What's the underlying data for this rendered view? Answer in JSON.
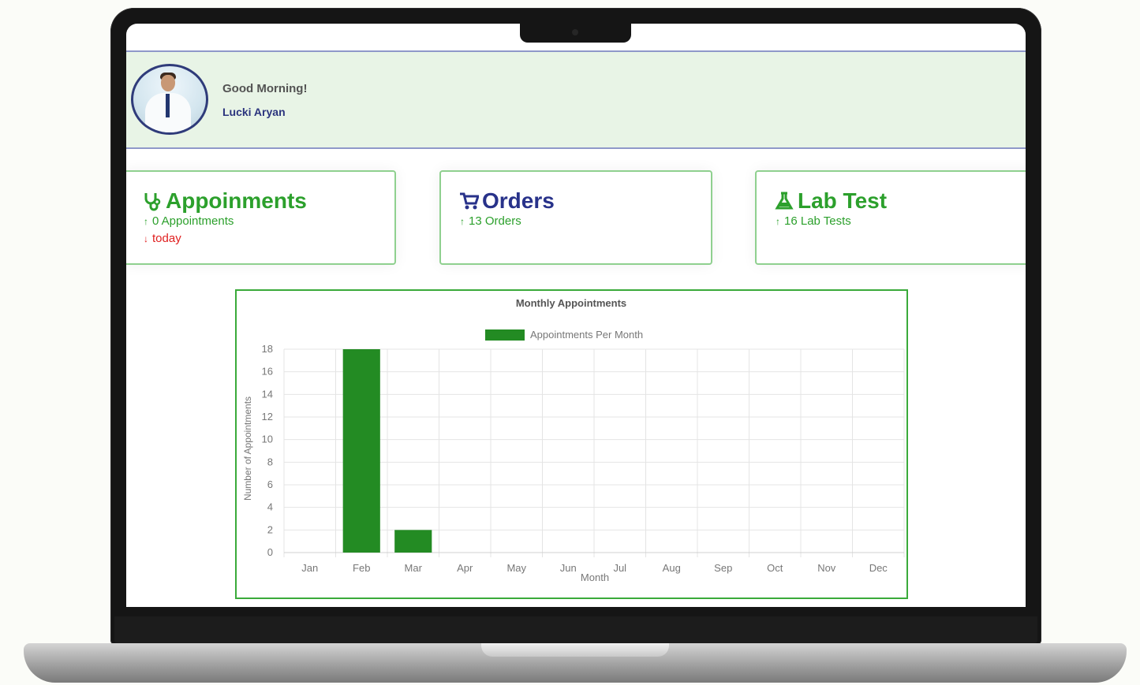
{
  "header": {
    "greeting": "Good Morning!",
    "user_name": "Lucki Aryan"
  },
  "cards": [
    {
      "title": "Appoinments",
      "icon": "stethoscope-icon",
      "stat": "0 Appointments",
      "note": "today",
      "title_color": "#2ca02c",
      "stat_color": "#2ca02c",
      "note_color": "#e02020"
    },
    {
      "title": "Orders",
      "icon": "cart-icon",
      "stat": "13 Orders",
      "title_color": "#28328a",
      "stat_color": "#2ca02c"
    },
    {
      "title": "Lab Test",
      "icon": "flask-icon",
      "stat": "16 Lab Tests",
      "title_color": "#2ca02c",
      "stat_color": "#2ca02c"
    }
  ],
  "colors": {
    "header_background": "#e8f4e6",
    "accent_green": "#238b23",
    "accent_navy": "#28328a"
  },
  "chart_data": {
    "type": "bar",
    "title": "Monthly Appointments",
    "categories": [
      "Jan",
      "Feb",
      "Mar",
      "Apr",
      "May",
      "Jun",
      "Jul",
      "Aug",
      "Sep",
      "Oct",
      "Nov",
      "Dec"
    ],
    "series": [
      {
        "name": "Appointments Per Month",
        "values": [
          0,
          18,
          2,
          0,
          0,
          0,
          0,
          0,
          0,
          0,
          0,
          0
        ],
        "color": "#238b23"
      }
    ],
    "xlabel": "Month",
    "ylabel": "Number of Appointments",
    "ylim": [
      0,
      18
    ],
    "yticks": [
      0,
      2,
      4,
      6,
      8,
      10,
      12,
      14,
      16,
      18
    ],
    "grid": true,
    "legend": "top-center"
  }
}
